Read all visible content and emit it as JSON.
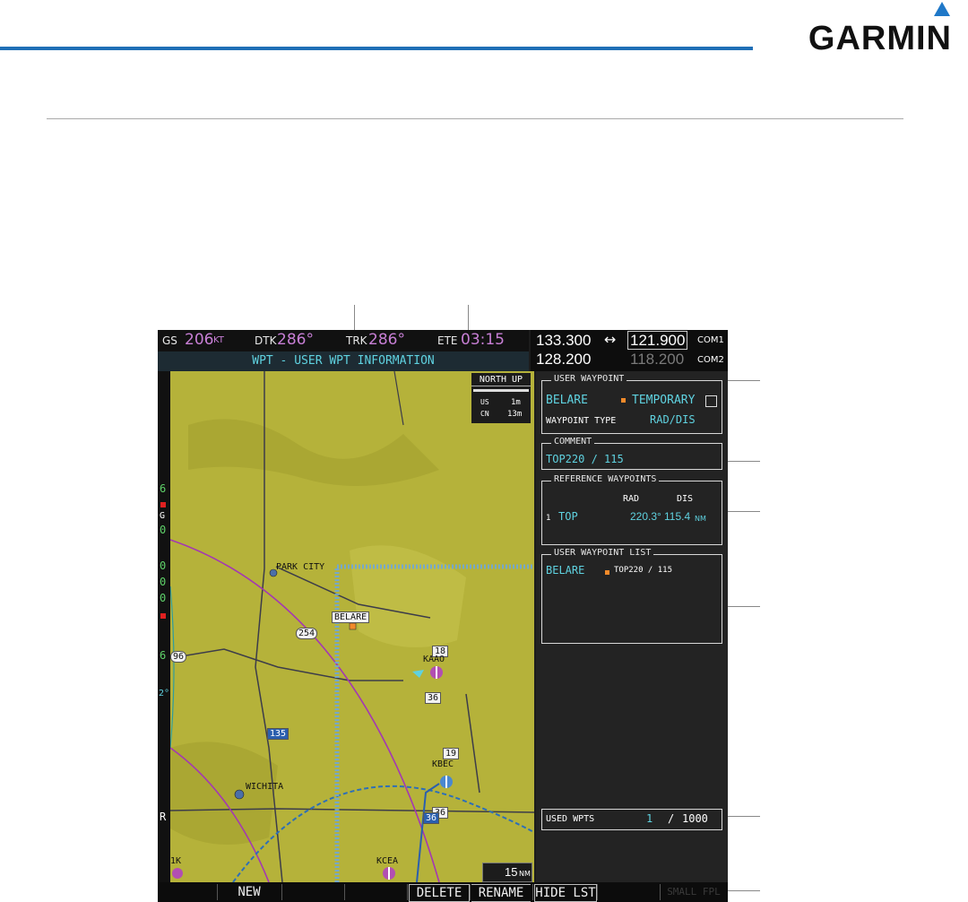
{
  "brand": {
    "logo_text": "GARMIN"
  },
  "nav": {
    "gs_label": "GS",
    "gs_value": "206",
    "gs_unit": "KT",
    "dtk_label": "DTK",
    "dtk_value": "286°",
    "trk_label": "TRK",
    "trk_value": "286°",
    "ete_label": "ETE",
    "ete_value": "03:15"
  },
  "page_title": "WPT - USER WPT INFORMATION",
  "com": {
    "com1_active": "133.300",
    "com1_standby": "121.900",
    "com1_label": "COM1",
    "swap_symbol": "↔",
    "com2_active": "128.200",
    "com2_standby": "118.200",
    "com2_label": "COM2"
  },
  "map": {
    "orientation": "NORTH UP",
    "legend": [
      {
        "label": "US",
        "value": "1m"
      },
      {
        "label": "CN",
        "value": "13m"
      }
    ],
    "range": "15",
    "range_unit": "NM",
    "labels": {
      "park_city": "PARK CITY",
      "belare": "BELARE",
      "kaao": "KAAO",
      "kbec": "KBEC",
      "wichita": "WICHITA",
      "kcea": "KCEA",
      "tag_18": "18",
      "tag_36a": "36",
      "tag_36b": "36",
      "tag_19": "19",
      "tag_36c": "36",
      "route_254": "254",
      "route_96": "96",
      "route_i135": "135",
      "hwy_36": "36",
      "kcea_tag": "17",
      "left_1k": "1K"
    }
  },
  "left_strip": [
    "6",
    "G",
    "0",
    "0",
    "0",
    "0",
    "6",
    "2°",
    "R"
  ],
  "user_waypoint": {
    "title": "USER WAYPOINT",
    "name": "BELARE",
    "temporary_label": "TEMPORARY",
    "type_label": "WAYPOINT TYPE",
    "type_value": "RAD/DIS"
  },
  "comment": {
    "title": "COMMENT",
    "text": "TOP220 / 115"
  },
  "reference_waypoints": {
    "title": "REFERENCE WAYPOINTS",
    "col_rad": "RAD",
    "col_dis": "DIS",
    "rows": [
      {
        "index": "1",
        "ident": "TOP",
        "rad": "220.3°",
        "dis": "115.4",
        "unit": "NM"
      }
    ]
  },
  "user_waypoint_list": {
    "title": "USER WAYPOINT LIST",
    "items": [
      {
        "name": "BELARE",
        "comment": "TOP220 / 115"
      }
    ]
  },
  "used_wpts": {
    "label": "USED WPTS",
    "count": "1",
    "sep": "/",
    "max": "1000"
  },
  "softkeys": [
    "",
    "NEW",
    "",
    "",
    "DELETE",
    "RENAME",
    "HIDE LST",
    "",
    "SMALL FPL"
  ],
  "colors": {
    "map_bg": "#b5b23a",
    "accent_blue": "#1f6fb6",
    "cyan": "#5fd2e0",
    "magenta": "#c87fd6",
    "user_wpt": "#f28a2a"
  }
}
